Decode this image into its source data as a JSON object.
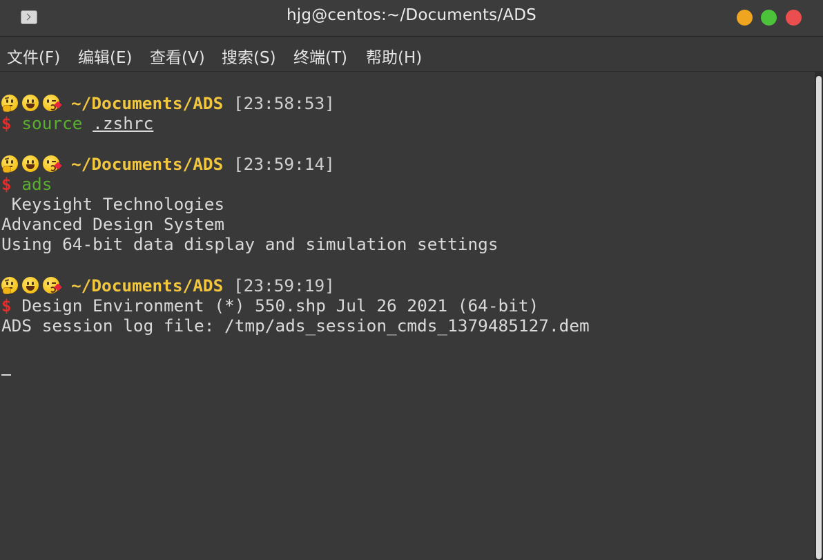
{
  "window": {
    "title": "hjg@centos:~/Documents/ADS",
    "controls": {
      "minimize_color": "#f0a521",
      "maximize_color": "#4cc23b",
      "close_color": "#ea4e4e"
    }
  },
  "menubar": {
    "items": [
      "文件(F)",
      "编辑(E)",
      "查看(V)",
      "搜索(S)",
      "终端(T)",
      "帮助(H)"
    ]
  },
  "terminal": {
    "prompt_path": "~/Documents/ADS",
    "prompt_symbol": "$",
    "blocks": [
      {
        "time": "[23:58:53]",
        "command": "source",
        "argument": ".zshrc",
        "output": []
      },
      {
        "time": "[23:59:14]",
        "command": "ads",
        "argument": "",
        "output": [
          " Keysight Technologies",
          "Advanced Design System",
          "Using 64-bit data display and simulation settings"
        ]
      },
      {
        "time": "[23:59:19]",
        "command": " Design Environment (*) 550.shp Jul 26 2021 (64-bit)",
        "argument": "",
        "output": [
          "ADS session log file: /tmp/ads_session_cmds_1379485127.dem"
        ]
      }
    ],
    "cursor": "_"
  },
  "colors": {
    "path": "#f2c73f",
    "dollar": "#e12c2c",
    "command": "#58b02e",
    "text": "#d9d9d9",
    "background": "#393939"
  }
}
